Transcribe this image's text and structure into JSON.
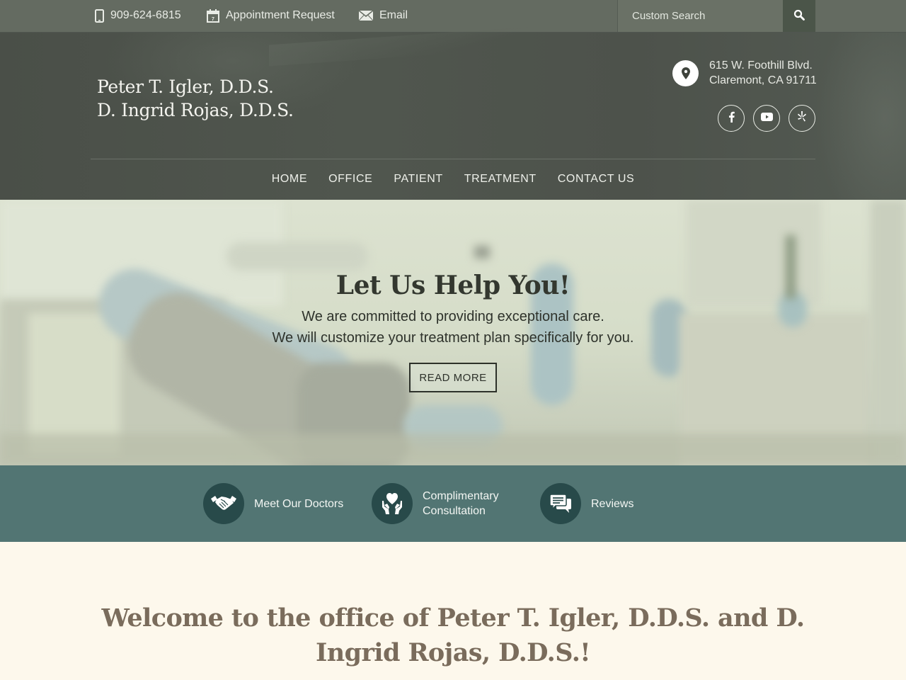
{
  "topbar": {
    "phone": "909-624-6815",
    "appointment": "Appointment Request",
    "email": "Email",
    "search": {
      "placeholder": "Custom Search",
      "value": ""
    },
    "icons": {
      "phone": "mobile-phone-icon",
      "appointment": "calendar-icon",
      "email": "envelope-icon",
      "search": "magnifier-icon"
    }
  },
  "header": {
    "doctors": [
      "Peter T. Igler, D.D.S.",
      "D. Ingrid Rojas, D.D.S."
    ],
    "address": [
      "615 W. Foothill Blvd.",
      "Claremont, CA 91711"
    ],
    "social": [
      "facebook",
      "youtube",
      "yelp"
    ]
  },
  "nav": {
    "items": [
      {
        "label": "HOME"
      },
      {
        "label": "OFFICE"
      },
      {
        "label": "PATIENT"
      },
      {
        "label": "TREATMENT"
      },
      {
        "label": "CONTACT US"
      }
    ]
  },
  "hero": {
    "title": "Let Us Help You!",
    "lines": [
      "We are committed to providing exceptional care.",
      "We will customize your treatment plan specifically for you."
    ],
    "button": "READ MORE"
  },
  "features": [
    {
      "label_lines": [
        "Meet Our Doctors"
      ],
      "icon": "handshake-icon"
    },
    {
      "label_lines": [
        "Complimentary",
        "Consultation"
      ],
      "icon": "heart-hands-icon"
    },
    {
      "label_lines": [
        "Reviews"
      ],
      "icon": "chat-bubbles-icon"
    }
  ],
  "welcome": {
    "heading": "Welcome to the office of Peter T. Igler, D.D.S. and D. Ingrid Rojas, D.D.S.!"
  },
  "colors": {
    "topbar": "#646b61",
    "header": "#4d524b",
    "feature_strip": "#527573",
    "feature_circle": "#284a4a",
    "page_bg": "#fdf8ec",
    "welcome_text": "#7a6c5c"
  }
}
